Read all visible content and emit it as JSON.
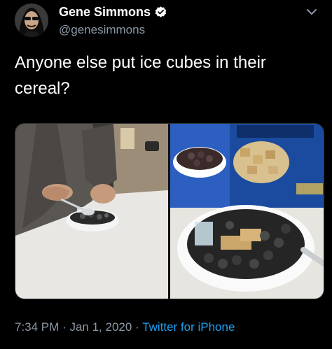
{
  "tweet": {
    "display_name": "Gene Simmons",
    "handle": "@genesimmons",
    "verified": true,
    "text": "Anyone else put ice cubes in their cereal?",
    "time": "7:34 PM",
    "separator": "·",
    "date": "Jan 1, 2020",
    "source": "Twitter for iPhone"
  },
  "colors": {
    "background": "#000000",
    "text": "#ffffff",
    "secondary_text": "#8b98a5",
    "link": "#1da1f2",
    "verified_badge": "#ffffff"
  },
  "icons": {
    "verified": "verified-badge-icon",
    "more": "chevron-down-icon"
  }
}
